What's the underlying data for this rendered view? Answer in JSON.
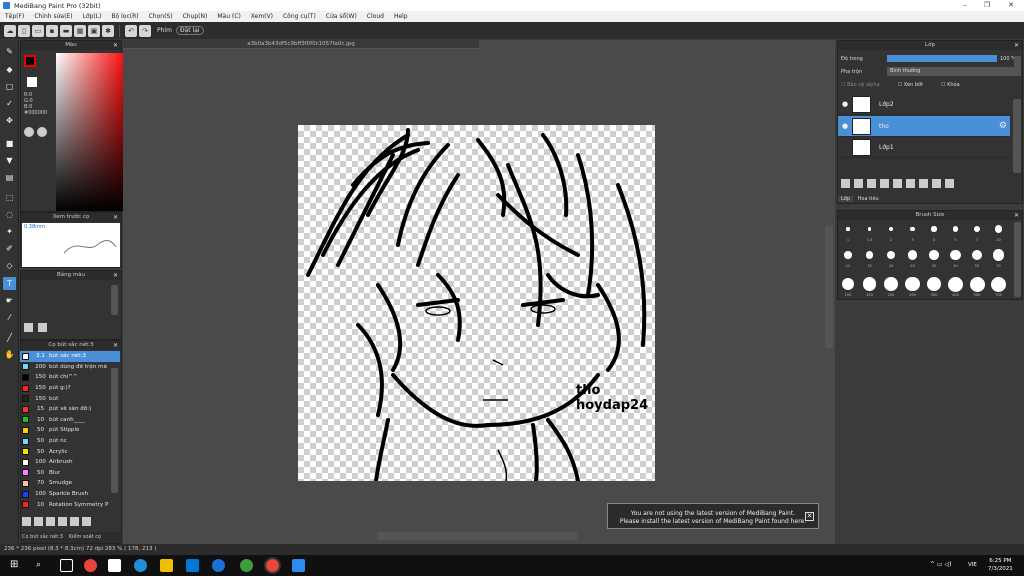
{
  "window": {
    "title": "MediBang Paint Pro (32bit)"
  },
  "menu": [
    "Tệp(F)",
    "Chỉnh sửa(E)",
    "Lớp(L)",
    "Bộ lọc(R)",
    "Chọn(S)",
    "Chụp(N)",
    "Màu (C)",
    "Xem(V)",
    "Công cụ(T)",
    "Cửa sổ(W)",
    "Cloud",
    "Help"
  ],
  "toolbar": {
    "label1": "Phím",
    "label2": "Đặt lại"
  },
  "color_panel": {
    "title": "Màu",
    "r": "R:0",
    "g": "G:0",
    "b": "B:0",
    "hex": "#000000"
  },
  "brush_preview": {
    "title": "Xem trước cọ",
    "size": "0.38mm"
  },
  "palette": {
    "title": "Bảng màu"
  },
  "brush_list": {
    "title": "Cọ bút sắc nét:3",
    "items": [
      {
        "size": "3.1",
        "name": "bút sắc nét:3",
        "color": "#ffffff"
      },
      {
        "size": "200",
        "name": "bút dùng để trộn mà",
        "color": "#6cd6ff"
      },
      {
        "size": "150",
        "name": "bút chì^^",
        "color": "#000000"
      },
      {
        "size": "150",
        "name": "pút g:)?",
        "color": "#ff2020"
      },
      {
        "size": "150",
        "name": "bút",
        "color": "#222222"
      },
      {
        "size": "15",
        "name": "pút vẽ sàn đồ:)",
        "color": "#ff3030"
      },
      {
        "size": "10",
        "name": "bút canh____",
        "color": "#20c020"
      },
      {
        "size": "50",
        "name": "pút Stipple",
        "color": "#ffd000"
      },
      {
        "size": "50",
        "name": "pút nc",
        "color": "#6cd6ff"
      },
      {
        "size": "50",
        "name": "Acrylic",
        "color": "#ffe000"
      },
      {
        "size": "100",
        "name": "Airbrush",
        "color": "#ffffff"
      },
      {
        "size": "50",
        "name": "Blur",
        "color": "#ff80ff"
      },
      {
        "size": "70",
        "name": "Smudge",
        "color": "#ffc0b0"
      },
      {
        "size": "100",
        "name": "Sparkle Brush",
        "color": "#2040ff"
      },
      {
        "size": "10",
        "name": "Rotation Symmetry P",
        "color": "#ff2020"
      }
    ],
    "tab1": "Cọ bút sắc nét:3",
    "tab2": "Kiểm soát cọ"
  },
  "document": {
    "tab": "a3b0a3b43df5c9bff3f0f0c1057fa0c.jpg",
    "text1": "tho",
    "text2": "hoydap24"
  },
  "toast": {
    "line1": "You are not using the latest version of MediBang Paint.",
    "line2": "Please install the latest version of MediBang Paint found here."
  },
  "layer_panel": {
    "title": "Lớp",
    "opacity_label": "Độ trong",
    "opacity_value": "100 %",
    "blend_label": "Pha trộn",
    "blend_value": "Bình thường",
    "opt1": "Bảo vệ alpha",
    "opt2": "Xén bớt",
    "opt3": "Khóa",
    "layers": [
      {
        "name": "Lớp2"
      },
      {
        "name": "tho"
      },
      {
        "name": "Lớp1"
      }
    ],
    "tab1": "Lớp",
    "tab2": "Hoa tiêu"
  },
  "brush_size": {
    "title": "Brush Size",
    "row1": [
      "1",
      "1.5",
      "2",
      "3",
      "4",
      "5",
      "7",
      "10"
    ],
    "row2": [
      "12",
      "15",
      "20",
      "25",
      "30",
      "40",
      "50",
      "70"
    ],
    "row3": [
      "100",
      "150",
      "200",
      "250",
      "300",
      "400",
      "500",
      "700",
      "1000"
    ]
  },
  "status": {
    "text": "236 * 236 pixel   (8.3 * 8.3cm)   72 dpi   283 %   ( 178, 213 )"
  },
  "taskbar": {
    "lang": "VIE",
    "time": "6:25 PM",
    "date": "7/3/2021"
  }
}
